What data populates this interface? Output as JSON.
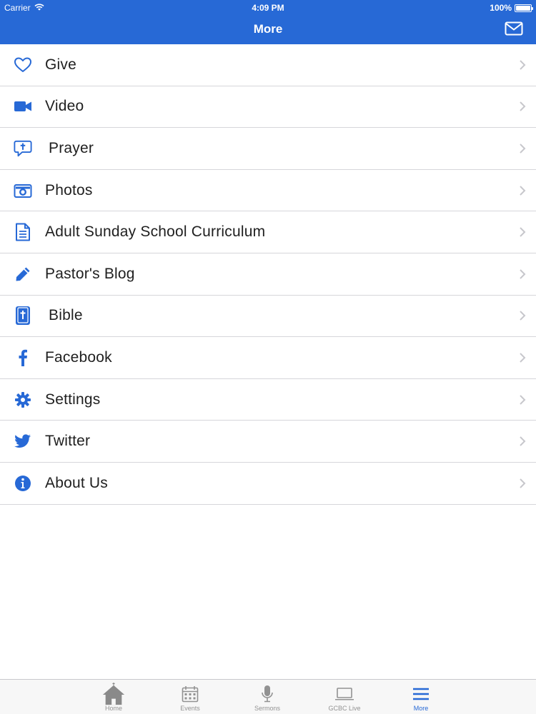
{
  "status_bar": {
    "carrier": "Carrier",
    "time": "4:09 PM",
    "battery": "100%"
  },
  "nav": {
    "title": "More"
  },
  "menu": {
    "items": [
      {
        "label": "Give",
        "icon": "heart-icon"
      },
      {
        "label": "Video",
        "icon": "video-camera-icon"
      },
      {
        "label": "Prayer",
        "icon": "prayer-bubble-icon"
      },
      {
        "label": "Photos",
        "icon": "camera-icon"
      },
      {
        "label": "Adult Sunday School Curriculum",
        "icon": "document-icon"
      },
      {
        "label": "Pastor's Blog",
        "icon": "pencil-icon"
      },
      {
        "label": "Bible",
        "icon": "bible-icon"
      },
      {
        "label": "Facebook",
        "icon": "facebook-icon"
      },
      {
        "label": "Settings",
        "icon": "gear-icon"
      },
      {
        "label": "Twitter",
        "icon": "twitter-icon"
      },
      {
        "label": "About Us",
        "icon": "info-icon"
      }
    ]
  },
  "tab_bar": {
    "tabs": [
      {
        "label": "Home",
        "icon": "church-icon",
        "active": false
      },
      {
        "label": "Events",
        "icon": "calendar-icon",
        "active": false
      },
      {
        "label": "Sermons",
        "icon": "microphone-icon",
        "active": false
      },
      {
        "label": "GCBC Live",
        "icon": "laptop-icon",
        "active": false
      },
      {
        "label": "More",
        "icon": "menu-icon",
        "active": true
      }
    ]
  },
  "colors": {
    "accent": "#2769d6",
    "separator": "#d6d6da",
    "tab_inactive": "#929292"
  }
}
